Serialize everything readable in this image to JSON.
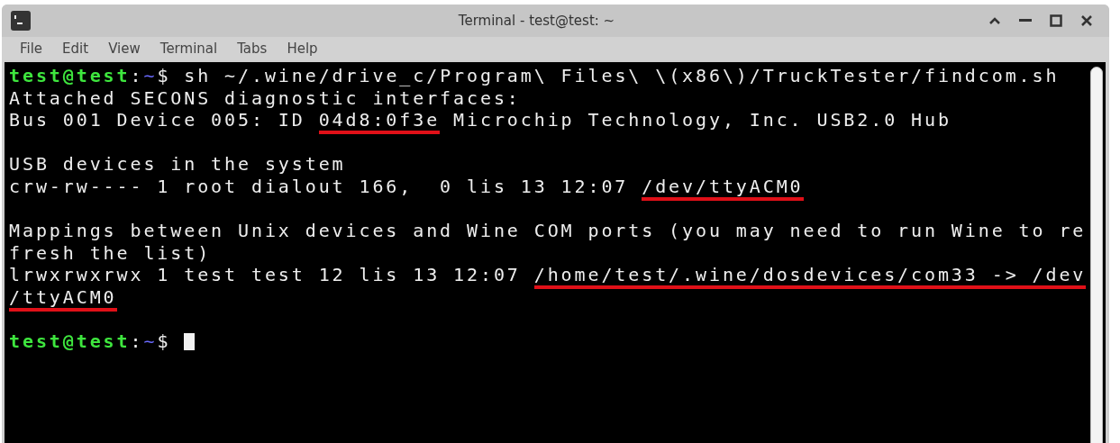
{
  "window": {
    "title": "Terminal - test@test: ~"
  },
  "menu": [
    "File",
    "Edit",
    "View",
    "Terminal",
    "Tabs",
    "Help"
  ],
  "terminal": {
    "lines": [
      {
        "kind": "output",
        "segments": [
          {
            "kind": "user",
            "text": "test@test",
            "underlined": false
          },
          {
            "kind": "sep",
            "text": ":",
            "underlined": false
          },
          {
            "kind": "path",
            "text": "~",
            "underlined": false
          },
          {
            "kind": "text",
            "text": "$ sh ~/.wine/drive_c/Program\\ Files\\ \\(x86\\)/TruckTester/findcom.sh",
            "underlined": false
          }
        ]
      },
      {
        "kind": "output",
        "segments": [
          {
            "kind": "text",
            "text": "Attached SECONS diagnostic interfaces:",
            "underlined": false
          }
        ]
      },
      {
        "kind": "output",
        "segments": [
          {
            "kind": "text",
            "text": "Bus 001 Device 005: ID ",
            "underlined": false
          },
          {
            "kind": "text",
            "text": "04d8:0f3e",
            "underlined": true
          },
          {
            "kind": "text",
            "text": " Microchip Technology, Inc. USB2.0 Hub",
            "underlined": false
          }
        ]
      },
      {
        "kind": "blank"
      },
      {
        "kind": "output",
        "segments": [
          {
            "kind": "text",
            "text": "USB devices in the system",
            "underlined": false
          }
        ]
      },
      {
        "kind": "output",
        "segments": [
          {
            "kind": "text",
            "text": "crw-rw---- 1 root dialout 166,  0 lis 13 12:07 ",
            "underlined": false
          },
          {
            "kind": "text",
            "text": "/dev/ttyACM0",
            "underlined": true
          }
        ]
      },
      {
        "kind": "blank"
      },
      {
        "kind": "output",
        "segments": [
          {
            "kind": "text",
            "text": "Mappings between Unix devices and Wine COM ports (you may need to run Wine to re",
            "underlined": false
          }
        ]
      },
      {
        "kind": "output",
        "segments": [
          {
            "kind": "text",
            "text": "fresh the list)",
            "underlined": false
          }
        ]
      },
      {
        "kind": "output",
        "segments": [
          {
            "kind": "text",
            "text": "lrwxrwxrwx 1 test test 12 lis 13 12:07 ",
            "underlined": false
          },
          {
            "kind": "text",
            "text": "/home/test/.wine/dosdevices/com33 -> /dev",
            "underlined": true
          }
        ]
      },
      {
        "kind": "output",
        "segments": [
          {
            "kind": "text",
            "text": "/ttyACM0",
            "underlined": true
          }
        ]
      },
      {
        "kind": "blank"
      },
      {
        "kind": "prompt",
        "segments": [
          {
            "kind": "user",
            "text": "test@test",
            "underlined": false
          },
          {
            "kind": "sep",
            "text": ":",
            "underlined": false
          },
          {
            "kind": "path",
            "text": "~",
            "underlined": false
          },
          {
            "kind": "text",
            "text": "$ ",
            "underlined": false
          }
        ]
      }
    ]
  }
}
